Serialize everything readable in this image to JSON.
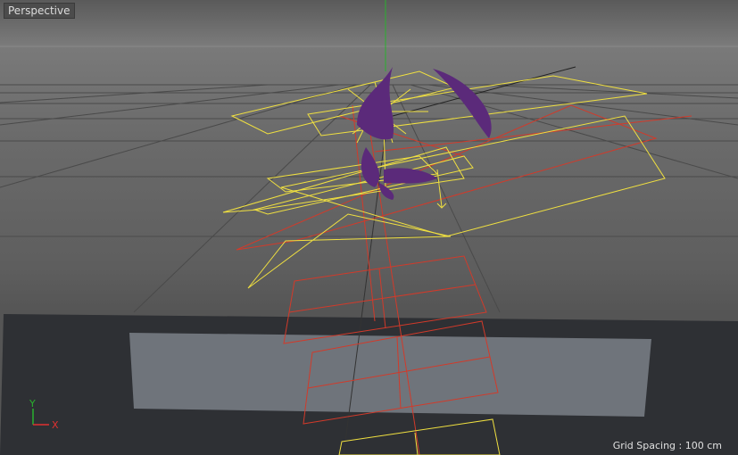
{
  "viewport": {
    "label": "Perspective",
    "grid_spacing": "Grid Spacing : 100 cm"
  },
  "axis_gizmo": {
    "y_label": "Y",
    "x_label": "X"
  },
  "colors": {
    "grid_line": "#4a4a4a",
    "floor_dark": "#2e3034",
    "back_panel": "#6f747b",
    "selection_yellow": "#f0e040",
    "hierarchy_red": "#d23a2a",
    "mesh_purple": "#5b2a7a",
    "y_axis_green": "#29b12e",
    "x_axis_red": "#e03030"
  }
}
